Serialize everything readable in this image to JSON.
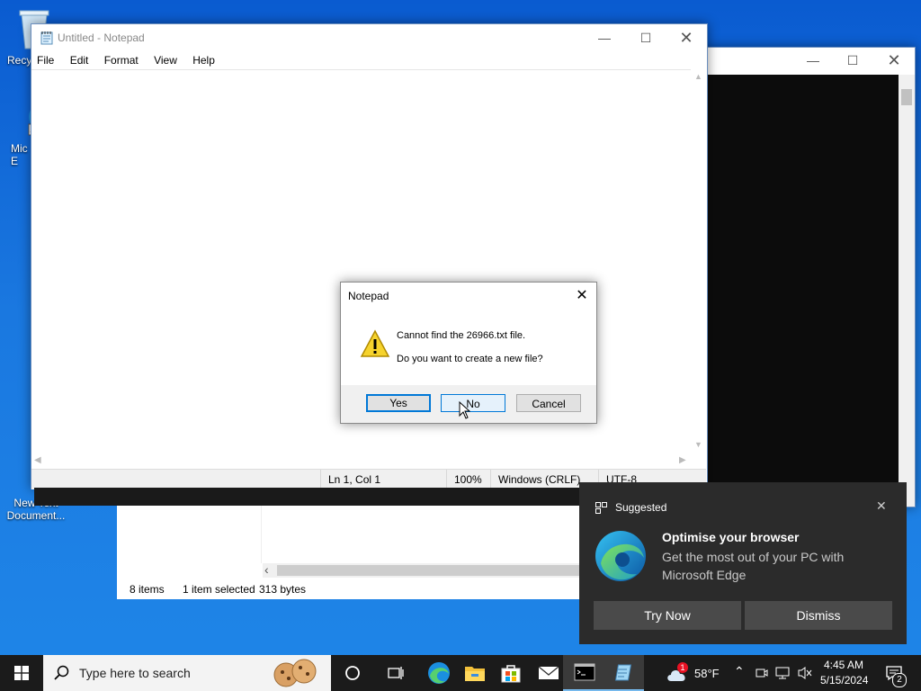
{
  "desktop": {
    "icons": [
      {
        "label": "Recy"
      },
      {
        "label": "Mic\nE"
      },
      {
        "label": "New Text\nDocument..."
      }
    ]
  },
  "explorer": {
    "status_items": "8 items",
    "status_selected": "1 item selected",
    "status_size": "313 bytes",
    "scroll_left": "‹"
  },
  "notepad": {
    "title": "Untitled - Notepad",
    "menu": [
      "File",
      "Edit",
      "Format",
      "View",
      "Help"
    ],
    "status": {
      "position": "Ln 1, Col 1",
      "zoom": "100%",
      "line_ending": "Windows (CRLF)",
      "encoding": "UTF-8"
    }
  },
  "dialog": {
    "title": "Notepad",
    "message_line1": "Cannot find the 26966.txt file.",
    "message_line2": "Do you want to create a new file?",
    "yes_label": "Yes",
    "no_label": "No",
    "cancel_label": "Cancel"
  },
  "toast": {
    "header": "Suggested",
    "heading": "Optimise your browser",
    "body": "Get the most out of your PC with Microsoft Edge",
    "try_label": "Try Now",
    "dismiss_label": "Dismiss"
  },
  "taskbar": {
    "search_placeholder": "Type here to search",
    "weather_temp": "58°F",
    "weather_badge": "1",
    "time": "4:45 AM",
    "date": "5/15/2024",
    "notification_count": "2"
  },
  "colors": {
    "accent": "#0078d7",
    "taskbar_bg": "#1b1b1b",
    "toast_bg": "#2b2b2b"
  }
}
